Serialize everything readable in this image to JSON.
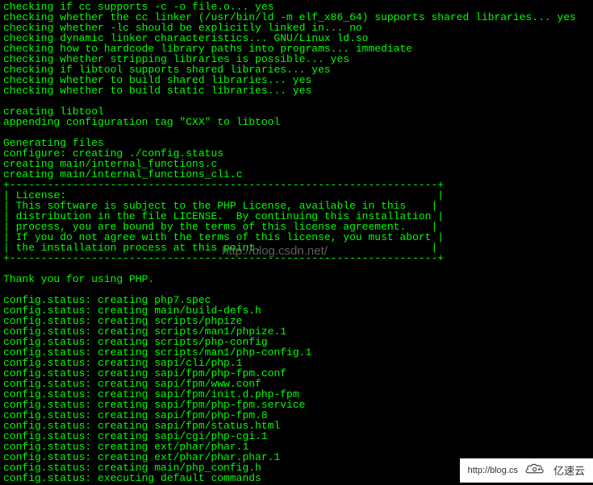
{
  "terminal": {
    "lines": [
      "checking if cc supports -c -o file.o... yes",
      "checking whether the cc linker (/usr/bin/ld -m elf_x86_64) supports shared libraries... yes",
      "checking whether -lc should be explicitly linked in... no",
      "checking dynamic linker characteristics... GNU/Linux ld.so",
      "checking how to hardcode library paths into programs... immediate",
      "checking whether stripping libraries is possible... yes",
      "checking if libtool supports shared libraries... yes",
      "checking whether to build shared libraries... yes",
      "checking whether to build static libraries... yes",
      "",
      "creating libtool",
      "appending configuration tag \"CXX\" to libtool",
      "",
      "Generating files",
      "configure: creating ./config.status",
      "creating main/internal_functions.c",
      "creating main/internal_functions_cli.c",
      "+--------------------------------------------------------------------+",
      "| License:                                                           |",
      "| This software is subject to the PHP License, available in this    |",
      "| distribution in the file LICENSE.  By continuing this installation |",
      "| process, you are bound by the terms of this license agreement.    |",
      "| If you do not agree with the terms of this license, you must abort |",
      "| the installation process at this point.                           |",
      "+--------------------------------------------------------------------+",
      "",
      "Thank you for using PHP.",
      "",
      "config.status: creating php7.spec",
      "config.status: creating main/build-defs.h",
      "config.status: creating scripts/phpize",
      "config.status: creating scripts/man1/phpize.1",
      "config.status: creating scripts/php-config",
      "config.status: creating scripts/man1/php-config.1",
      "config.status: creating sapi/cli/php.1",
      "config.status: creating sapi/fpm/php-fpm.conf",
      "config.status: creating sapi/fpm/www.conf",
      "config.status: creating sapi/fpm/init.d.php-fpm",
      "config.status: creating sapi/fpm/php-fpm.service",
      "config.status: creating sapi/fpm/php-fpm.8",
      "config.status: creating sapi/fpm/status.html",
      "config.status: creating sapi/cgi/php-cgi.1",
      "config.status: creating ext/phar/phar.1",
      "config.status: creating ext/phar/phar.phar.1",
      "config.status: creating main/php_config.h",
      "config.status: executing default commands"
    ]
  },
  "watermark_center": "http://blog.csdn.net/",
  "watermark_corner": {
    "text": "http://blog.cs",
    "brand": "亿速云"
  }
}
